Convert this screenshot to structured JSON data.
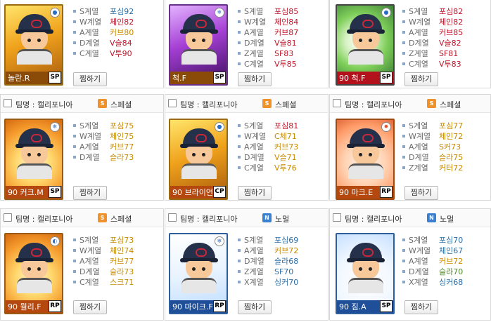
{
  "cards": [
    {
      "id": "r0c0",
      "has_header": false,
      "team_label": "",
      "type_label": "",
      "type_badge": "",
      "name": "놀란.R",
      "position": "SP",
      "icon": "baseball-ball-icon",
      "stats": [
        {
          "label": "S계열",
          "value": "포심92",
          "color": "blue"
        },
        {
          "label": "W계열",
          "value": "체인82",
          "color": "red"
        },
        {
          "label": "A계열",
          "value": "커브80",
          "color": "orange"
        },
        {
          "label": "D계열",
          "value": "V슬84",
          "color": "red"
        },
        {
          "label": "C계열",
          "value": "V투90",
          "color": "red"
        }
      ],
      "button": "찜하기"
    },
    {
      "id": "r0c1",
      "has_header": false,
      "team_label": "",
      "type_label": "",
      "type_badge": "",
      "name": "척.F",
      "position": "SP",
      "icon": "snowflake-icon",
      "stats": [
        {
          "label": "S계열",
          "value": "포심85",
          "color": "red"
        },
        {
          "label": "W계열",
          "value": "체인84",
          "color": "red"
        },
        {
          "label": "A계열",
          "value": "커브87",
          "color": "red"
        },
        {
          "label": "D계열",
          "value": "V슬81",
          "color": "red"
        },
        {
          "label": "Z계열",
          "value": "SF83",
          "color": "red"
        },
        {
          "label": "C계열",
          "value": "V투85",
          "color": "red"
        }
      ],
      "button": "찜하기"
    },
    {
      "id": "r0c2",
      "has_header": false,
      "team_label": "",
      "type_label": "",
      "type_badge": "",
      "name": "90 척.F",
      "position": "SP",
      "icon": "baseball-ball-icon",
      "stats": [
        {
          "label": "S계열",
          "value": "포심82",
          "color": "red"
        },
        {
          "label": "W계열",
          "value": "체인82",
          "color": "red"
        },
        {
          "label": "A계열",
          "value": "커브85",
          "color": "red"
        },
        {
          "label": "D계열",
          "value": "V슬82",
          "color": "red"
        },
        {
          "label": "Z계열",
          "value": "SF81",
          "color": "red"
        },
        {
          "label": "C계열",
          "value": "V투83",
          "color": "red"
        }
      ],
      "button": "찜하기"
    },
    {
      "id": "r1c0",
      "has_header": true,
      "team_label": "팀명 : 캘리포니아",
      "type_label": "스페셜",
      "type_badge": "S",
      "name": "90 커크.M",
      "position": "SP",
      "icon": "snowflake-icon",
      "stats": [
        {
          "label": "S계열",
          "value": "포심75",
          "color": "orange"
        },
        {
          "label": "W계열",
          "value": "체인75",
          "color": "orange"
        },
        {
          "label": "A계열",
          "value": "커브77",
          "color": "orange"
        },
        {
          "label": "D계열",
          "value": "슬라73",
          "color": "orange"
        }
      ],
      "button": "찜하기"
    },
    {
      "id": "r1c1",
      "has_header": true,
      "team_label": "팀명 : 캘리포니아",
      "type_label": "스페셜",
      "type_badge": "S",
      "name": "90 브라이언.H",
      "position": "CP",
      "icon": "baseball-ball-icon",
      "stats": [
        {
          "label": "S계열",
          "value": "포심81",
          "color": "red"
        },
        {
          "label": "W계열",
          "value": "C체71",
          "color": "orange"
        },
        {
          "label": "A계열",
          "value": "커브73",
          "color": "orange"
        },
        {
          "label": "D계열",
          "value": "V슬71",
          "color": "orange"
        },
        {
          "label": "C계열",
          "value": "V투76",
          "color": "orange"
        }
      ],
      "button": "찜하기"
    },
    {
      "id": "r1c2",
      "has_header": true,
      "team_label": "팀명 : 캘리포니아",
      "type_label": "스페셜",
      "type_badge": "S",
      "name": "90 마크.E",
      "position": "RP",
      "icon": "sun-icon",
      "stats": [
        {
          "label": "S계열",
          "value": "포심77",
          "color": "orange"
        },
        {
          "label": "W계열",
          "value": "체인72",
          "color": "orange"
        },
        {
          "label": "A계열",
          "value": "S커73",
          "color": "orange"
        },
        {
          "label": "D계열",
          "value": "슬라75",
          "color": "orange"
        },
        {
          "label": "Z계열",
          "value": "커터72",
          "color": "orange"
        }
      ],
      "button": "찜하기"
    },
    {
      "id": "r2c0",
      "has_header": true,
      "team_label": "팀명 : 캘리포니아",
      "type_label": "스페셜",
      "type_badge": "S",
      "name": "90 월리.F",
      "position": "RP",
      "icon": "half-moon-icon",
      "stats": [
        {
          "label": "S계열",
          "value": "포심73",
          "color": "orange"
        },
        {
          "label": "W계열",
          "value": "체인74",
          "color": "orange"
        },
        {
          "label": "A계열",
          "value": "커브77",
          "color": "orange"
        },
        {
          "label": "D계열",
          "value": "슬라73",
          "color": "orange"
        },
        {
          "label": "C계열",
          "value": "스크71",
          "color": "orange"
        }
      ],
      "button": "찜하기"
    },
    {
      "id": "r2c1",
      "has_header": true,
      "team_label": "팀명 : 캘리포니아",
      "type_label": "노멀",
      "type_badge": "N",
      "name": "90 마이크.F",
      "position": "RP",
      "icon": "snowflake-icon",
      "stats": [
        {
          "label": "S계열",
          "value": "포심69",
          "color": "blue"
        },
        {
          "label": "A계열",
          "value": "커브72",
          "color": "orange"
        },
        {
          "label": "D계열",
          "value": "슬라68",
          "color": "blue"
        },
        {
          "label": "Z계열",
          "value": "SF70",
          "color": "blue"
        },
        {
          "label": "X계열",
          "value": "싱커70",
          "color": "blue"
        }
      ],
      "button": "찜하기"
    },
    {
      "id": "r2c2",
      "has_header": true,
      "team_label": "팀명 : 캘리포니아",
      "type_label": "노멀",
      "type_badge": "N",
      "name": "90 짐.A",
      "position": "SP",
      "icon": "",
      "stats": [
        {
          "label": "S계열",
          "value": "포심70",
          "color": "blue"
        },
        {
          "label": "W계열",
          "value": "체인67",
          "color": "blue"
        },
        {
          "label": "A계열",
          "value": "커브72",
          "color": "orange"
        },
        {
          "label": "D계열",
          "value": "슬라70",
          "color": "green"
        },
        {
          "label": "X계열",
          "value": "싱커68",
          "color": "blue"
        }
      ],
      "button": "찜하기"
    }
  ]
}
